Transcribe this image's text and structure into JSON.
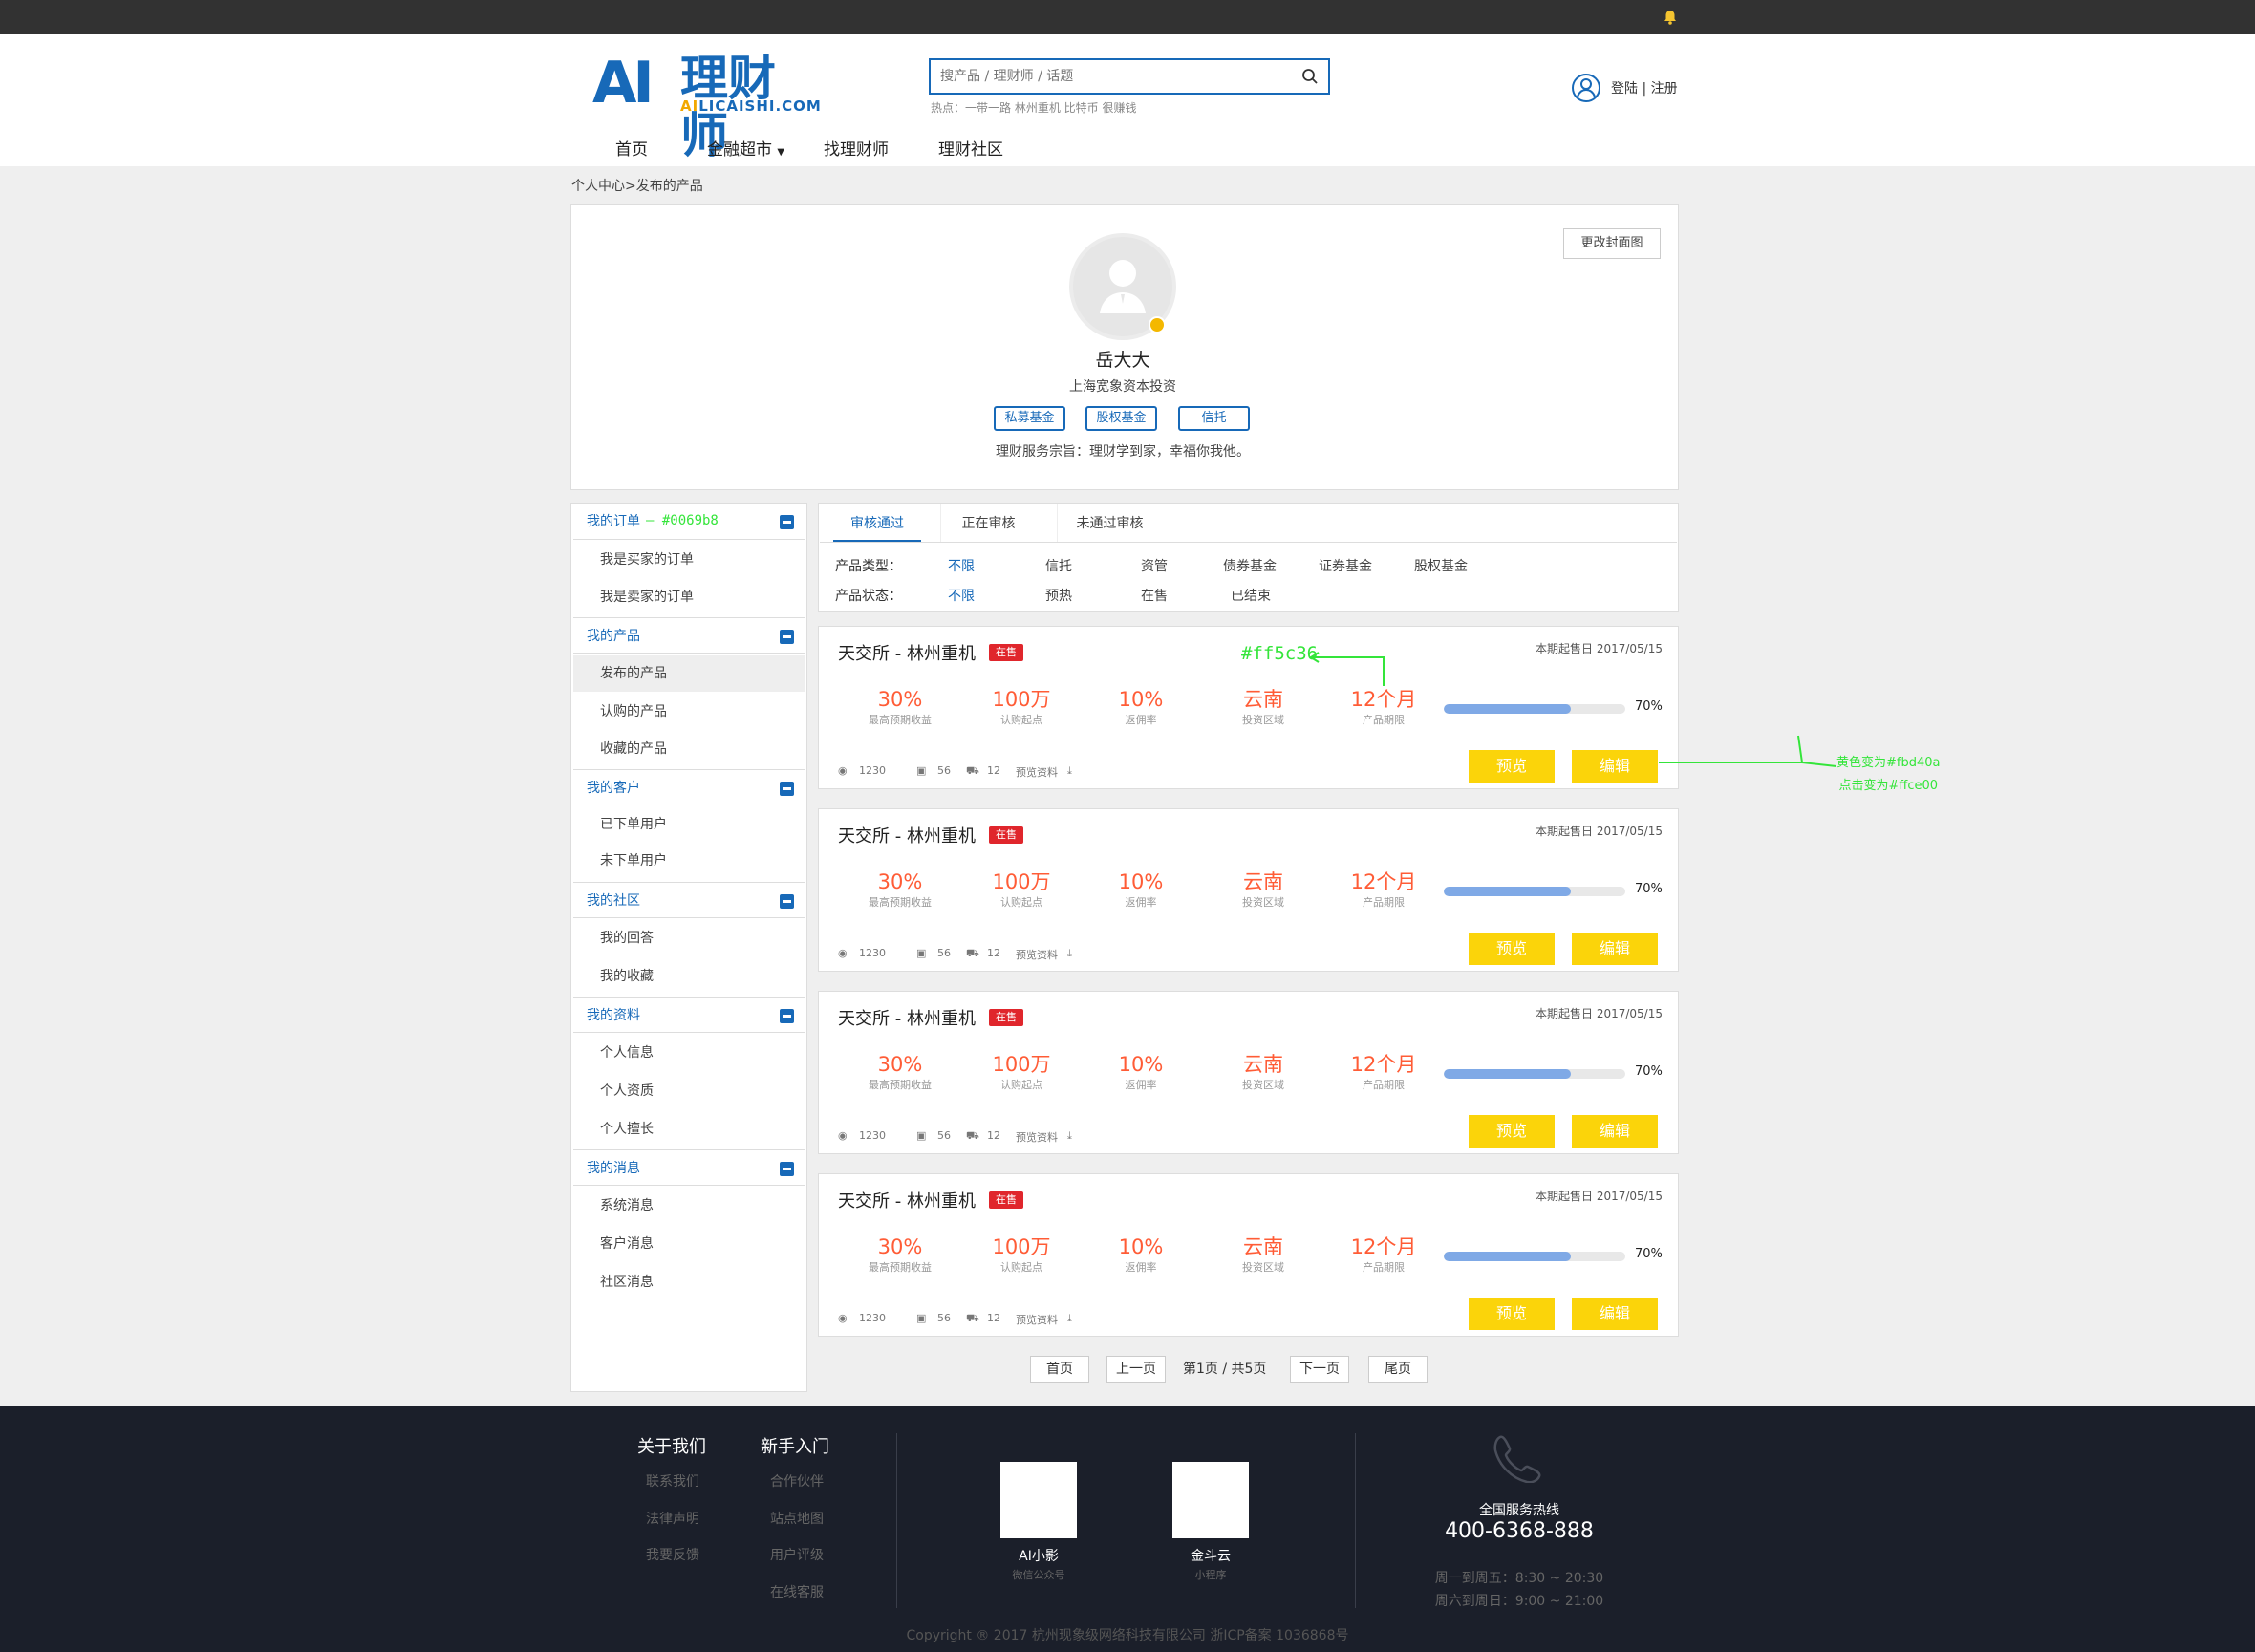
{
  "topbar": {
    "bell_icon": "bell-icon"
  },
  "header": {
    "logo_mark": "AI",
    "logo_text": "理财师",
    "logo_en_1": "AI",
    "logo_en_2": "LICAISHI.COM",
    "search_placeholder": "搜产品 / 理财师 / 话题",
    "hot": "热点：一带一路 林州重机 比特币 很赚钱",
    "login": "登陆 | 注册",
    "nav": [
      "首页",
      "金融超市",
      "找理财师",
      "理财社区"
    ]
  },
  "breadcrumb": "个人中心>发布的产品",
  "profile": {
    "cover_button": "更改封面图",
    "name": "岳大大",
    "company": "上海宽象资本投资",
    "tags": [
      "私募基金",
      "股权基金",
      "信托"
    ],
    "motto": "理财服务宗旨：理财学到家，幸福你我他。"
  },
  "sidebar": [
    {
      "title": "我的订单",
      "items": [
        "我是买家的订单",
        "我是卖家的订单"
      ]
    },
    {
      "title": "我的产品",
      "items": [
        "发布的产品",
        "认购的产品",
        "收藏的产品"
      ]
    },
    {
      "title": "我的客户",
      "items": [
        "已下单用户",
        "未下单用户"
      ]
    },
    {
      "title": "我的社区",
      "items": [
        "我的回答",
        "我的收藏"
      ]
    },
    {
      "title": "我的资料",
      "items": [
        "个人信息",
        "个人资质",
        "个人擅长"
      ]
    },
    {
      "title": "我的消息",
      "items": [
        "系统消息",
        "客户消息",
        "社区消息"
      ]
    }
  ],
  "annotations": {
    "sidebar_color": "— #0069b8",
    "value_color": "#ff5c36",
    "button_color_1": "黄色变为#fbd40a",
    "button_color_2": "点击变为#ffce00"
  },
  "tabs": [
    "审核通过",
    "正在审核",
    "未通过审核"
  ],
  "filters": {
    "type_label": "产品类型：",
    "types": [
      "不限",
      "信托",
      "资管",
      "债券基金",
      "证券基金",
      "股权基金"
    ],
    "status_label": "产品状态：",
    "statuses": [
      "不限",
      "预热",
      "在售",
      "已结束"
    ]
  },
  "products": [
    {
      "title": "天交所 - 林州重机",
      "badge": "在售",
      "date": "本期起售日 2017/05/15",
      "stats": [
        {
          "v": "30%",
          "l": "最高预期收益"
        },
        {
          "v": "100万",
          "l": "认购起点"
        },
        {
          "v": "10%",
          "l": "返佣率"
        },
        {
          "v": "云南",
          "l": "投资区域"
        },
        {
          "v": "12个月",
          "l": "产品期限"
        }
      ],
      "progress": 70,
      "progress_label": "70%",
      "views": "1230",
      "comments": "56",
      "carts": "12",
      "docs": "预览资料",
      "preview": "预览",
      "edit": "编辑"
    },
    {
      "title": "天交所 - 林州重机",
      "badge": "在售",
      "date": "本期起售日 2017/05/15",
      "stats": [
        {
          "v": "30%",
          "l": "最高预期收益"
        },
        {
          "v": "100万",
          "l": "认购起点"
        },
        {
          "v": "10%",
          "l": "返佣率"
        },
        {
          "v": "云南",
          "l": "投资区域"
        },
        {
          "v": "12个月",
          "l": "产品期限"
        }
      ],
      "progress": 70,
      "progress_label": "70%",
      "views": "1230",
      "comments": "56",
      "carts": "12",
      "docs": "预览资料",
      "preview": "预览",
      "edit": "编辑"
    },
    {
      "title": "天交所 - 林州重机",
      "badge": "在售",
      "date": "本期起售日 2017/05/15",
      "stats": [
        {
          "v": "30%",
          "l": "最高预期收益"
        },
        {
          "v": "100万",
          "l": "认购起点"
        },
        {
          "v": "10%",
          "l": "返佣率"
        },
        {
          "v": "云南",
          "l": "投资区域"
        },
        {
          "v": "12个月",
          "l": "产品期限"
        }
      ],
      "progress": 70,
      "progress_label": "70%",
      "views": "1230",
      "comments": "56",
      "carts": "12",
      "docs": "预览资料",
      "preview": "预览",
      "edit": "编辑"
    },
    {
      "title": "天交所 - 林州重机",
      "badge": "在售",
      "date": "本期起售日 2017/05/15",
      "stats": [
        {
          "v": "30%",
          "l": "最高预期收益"
        },
        {
          "v": "100万",
          "l": "认购起点"
        },
        {
          "v": "10%",
          "l": "返佣率"
        },
        {
          "v": "云南",
          "l": "投资区域"
        },
        {
          "v": "12个月",
          "l": "产品期限"
        }
      ],
      "progress": 70,
      "progress_label": "70%",
      "views": "1230",
      "comments": "56",
      "carts": "12",
      "docs": "预览资料",
      "preview": "预览",
      "edit": "编辑"
    }
  ],
  "pager": {
    "first": "首页",
    "prev": "上一页",
    "info": "第1页 / 共5页",
    "next": "下一页",
    "last": "尾页"
  },
  "footer": {
    "col1_title": "关于我们",
    "col1": [
      "联系我们",
      "法律声明",
      "我要反馈"
    ],
    "col2_title": "新手入门",
    "col2": [
      "合作伙伴",
      "站点地图",
      "用户评级",
      "在线客服"
    ],
    "qr1_name": "AI小影",
    "qr1_sub": "微信公众号",
    "qr2_name": "金斗云",
    "qr2_sub": "小程序",
    "hotline_label": "全国服务热线",
    "hotline": "400-6368-888",
    "hours1": "周一到周五：8:30 ~ 20:30",
    "hours2": "周六到周日：9:00 ~ 21:00",
    "copyright": "Copyright ® 2017 杭州现象级网络科技有限公司 浙ICP备案 1036868号"
  },
  "colors": {
    "brand": "#1769b8",
    "accent": "#ff5c36",
    "button": "#fbd40a",
    "note": "#34e53a",
    "footer": "#1b1f2a"
  }
}
